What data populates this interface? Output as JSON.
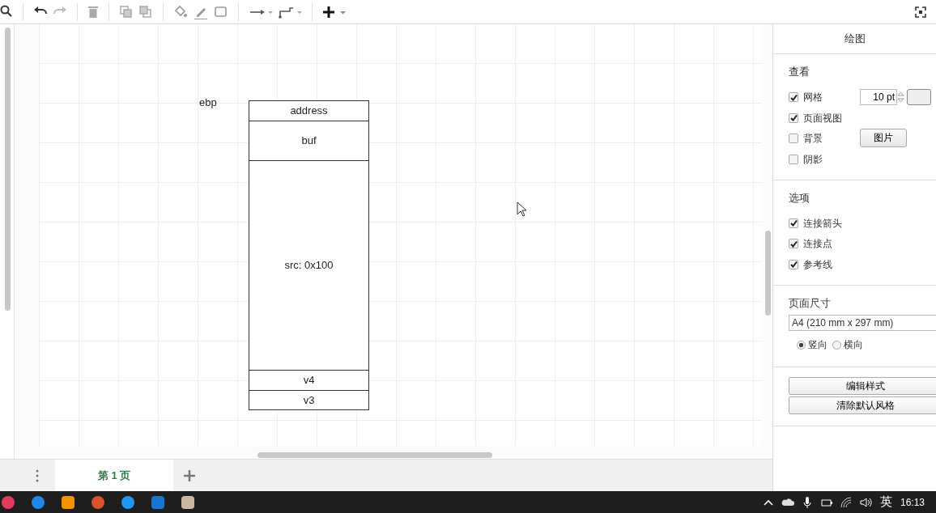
{
  "diagram": {
    "label": "ebp",
    "stack": [
      {
        "label": "address"
      },
      {
        "label": "buf"
      },
      {
        "label": "src: 0x100"
      },
      {
        "label": "v4"
      },
      {
        "label": "v3"
      }
    ]
  },
  "panel": {
    "title": "绘图",
    "view": {
      "heading": "查看",
      "options": [
        {
          "label": "网格",
          "checked": true
        },
        {
          "label": "页面视图",
          "checked": true
        },
        {
          "label": "背景",
          "checked": false
        },
        {
          "label": "阴影",
          "checked": false
        }
      ],
      "grid_size": "10 pt",
      "image_button": "图片"
    },
    "options": {
      "heading": "选项",
      "items": [
        {
          "label": "连接箭头",
          "checked": true
        },
        {
          "label": "连接点",
          "checked": true
        },
        {
          "label": "参考线",
          "checked": true
        }
      ]
    },
    "page_size": {
      "heading": "页面尺寸",
      "value": "A4 (210 mm x 297 mm)",
      "orientations": [
        {
          "label": "竖向",
          "selected": true
        },
        {
          "label": "横向",
          "selected": false
        }
      ]
    },
    "buttons": [
      "编辑样式",
      "清除默认风格"
    ]
  },
  "pages": [
    {
      "label": "第 1 页",
      "selected": true
    }
  ],
  "tray": {
    "input_method": "英",
    "time": "16:13"
  }
}
